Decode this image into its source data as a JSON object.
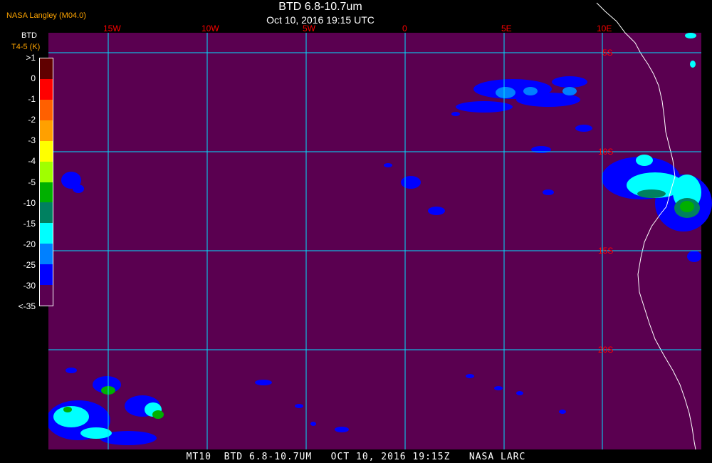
{
  "header": {
    "agency": "NASA Langley (M04.0)",
    "title": "BTD 6.8-10.7um",
    "subtitle": "Oct 10, 2016 19:15 UTC"
  },
  "footer": {
    "text": "MT10  BTD 6.8-10.7UM   OCT 10, 2016 19:15Z   NASA LARC"
  },
  "legend": {
    "title": "BTD",
    "unit": "T4-5 (K)",
    "labels": [
      ">1",
      "0",
      "-1",
      "-2",
      "-3",
      "-4",
      "-5",
      "-10",
      "-15",
      "-20",
      "-25",
      "-30",
      "<-35"
    ],
    "colors": [
      "#600000",
      "#ff0000",
      "#ff6000",
      "#ffa000",
      "#ffff00",
      "#a0ff00",
      "#00b000",
      "#008060",
      "#00ffff",
      "#0080ff",
      "#0000ff",
      "#5a0050"
    ]
  },
  "grid": {
    "longitude_labels": [
      "15W",
      "10W",
      "5W",
      "0",
      "5E",
      "10E"
    ],
    "latitude_labels": [
      "5S",
      "10S",
      "15S",
      "20S"
    ]
  },
  "colors": {
    "background": "#5a0050",
    "gridline": "#00e0ff",
    "grid_label": "#ff0000",
    "coastline": "#ffffff"
  }
}
